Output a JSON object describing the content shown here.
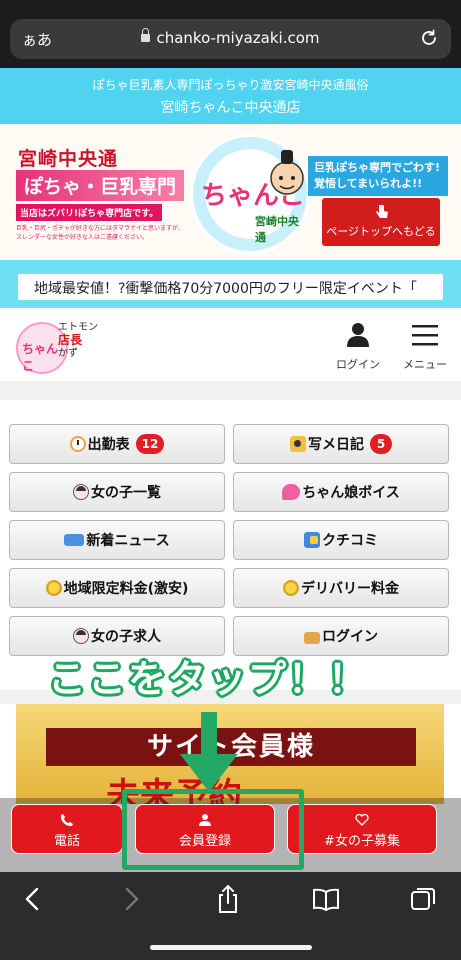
{
  "browser": {
    "aa_label": "ぁあ",
    "url": "chanko-miyazaki.com"
  },
  "site": {
    "tagline": "ぽちゃ巨乳素人専門ぽっちゃり激安宮崎中央通風俗",
    "name": "宮崎ちゃんこ中央通店"
  },
  "banner": {
    "area_title": "宮崎中央通",
    "genre_title": "ぽちゃ・巨乳専門",
    "notice": "当店はズバリ!ぽちゃ専門店です。",
    "description": "巨乳・巨尻・ポチャが好きな方にはタマラナイと思いますが、スレンダーな女性が好きな人はご遠慮ください。",
    "mascot_char": "ちゃんこ",
    "mascot_store": "宮崎中央通",
    "slogan": "巨乳ぽちゃ専門でごわす!覚悟してまいられよ!!",
    "page_top_button": "ページトップへもどる"
  },
  "marquee": {
    "text": "地域最安値！?衝撃価格70分7000円のフリー限定イベント「"
  },
  "nav": {
    "logo_char": "ちゃんこ",
    "logo_line1": "エトモン",
    "logo_line2": "店長",
    "logo_line3": "かず",
    "login_label": "ログイン",
    "menu_label": "メニュー"
  },
  "menu_grid": [
    {
      "label": "出勤表",
      "icon": "clock-icon",
      "badge": "12"
    },
    {
      "label": "写メ日記",
      "icon": "camera-icon",
      "badge": "5"
    },
    {
      "label": "女の子一覧",
      "icon": "girl-icon",
      "badge": ""
    },
    {
      "label": "ちゃん娘ボイス",
      "icon": "speech-bubble-icon",
      "badge": ""
    },
    {
      "label": "新着ニュース",
      "icon": "news-icon",
      "badge": ""
    },
    {
      "label": "クチコミ",
      "icon": "review-chat-icon",
      "badge": ""
    },
    {
      "label": "地域限定料金(激安)",
      "icon": "coin-icon",
      "badge": ""
    },
    {
      "label": "デリバリー料金",
      "icon": "coin-icon",
      "badge": ""
    },
    {
      "label": "女の子求人",
      "icon": "girl-icon",
      "badge": ""
    },
    {
      "label": "ログイン",
      "icon": "lock-icon",
      "badge": ""
    }
  ],
  "annotation": {
    "text": "ここをタップ！！",
    "color": "#23a865"
  },
  "promo": {
    "band_text": "サイト会員様",
    "red_text": "未来予約"
  },
  "cta": {
    "phone": "電話",
    "register": "会員登録",
    "recruit": "#女の子募集"
  },
  "colors": {
    "accent_cyan": "#4fd3f0",
    "cta_red": "#e1181e",
    "badge_red": "#e11d25",
    "highlight_green": "#23a865"
  }
}
